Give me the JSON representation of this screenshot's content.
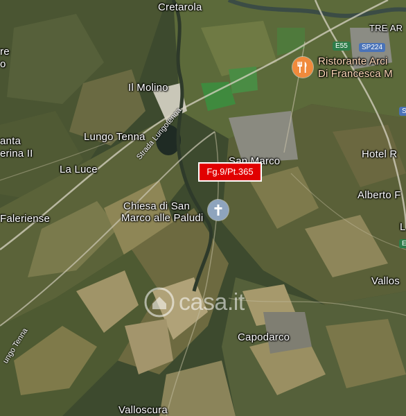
{
  "map": {
    "places": {
      "cretarola": "Cretarola",
      "tre_archi": "TRE AR",
      "il_molino": "Il Molino",
      "lungo_tenna": "Lungo Tenna",
      "santa_caterina_1": "anta",
      "santa_caterina_2": "erina II",
      "la_luce": "La Luce",
      "faleriense": "Faleriense",
      "san_marco": "San Marco",
      "hotel": "Hotel R",
      "alberto": "Alberto F",
      "vallos": "Vallos",
      "capodarco": "Capodarco",
      "valloscura": "Valloscura",
      "left_top_1": "re",
      "left_top_2": "o",
      "right_l": "L"
    },
    "roads": {
      "strada_lungotenna": "Strada Lungotenna",
      "ungo_tenna": "ungo Tenna",
      "e55": "E55",
      "sp224": "SP224",
      "s_right": "S",
      "e_right": "E"
    },
    "pois": {
      "church_line1": "Chiesa di San",
      "church_line2": "Marco alle Paludi",
      "restaurant_line1": "Ristorante Arci",
      "restaurant_line2": "Di Francesca M",
      "church_icon": "cross-icon",
      "restaurant_icon": "fork-knife-icon",
      "church_color": "#8ea4bd",
      "restaurant_color": "#f08a3c"
    },
    "parcel_label": "Fg.9/Pt.365",
    "watermark": {
      "brand": "casa.it"
    }
  }
}
